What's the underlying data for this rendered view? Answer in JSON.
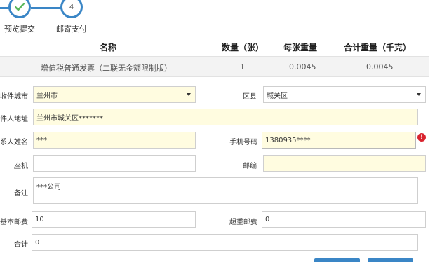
{
  "stepper": {
    "steps": [
      {
        "label": "预览提交",
        "number": "",
        "icon": "check-icon",
        "state": "done"
      },
      {
        "label": "邮寄支付",
        "number": "4",
        "icon": "",
        "state": "current"
      }
    ],
    "accent": "#3a86c6"
  },
  "table": {
    "headers": {
      "name": "名称",
      "qty": "数量（张）",
      "unit_weight": "每张重量",
      "total_weight": "合计重量（千克）"
    },
    "row": {
      "name": "增值税普通发票（二联无金额限制版）",
      "qty": "1",
      "unit_weight": "0.0045",
      "total_weight": "0.0045"
    }
  },
  "form": {
    "city": {
      "label": "收件城市",
      "value": "兰州市"
    },
    "district": {
      "label": "区县",
      "value": "城关区"
    },
    "address": {
      "label": "件人地址",
      "value": "兰州市城关区*******"
    },
    "contact": {
      "label": "系人姓名",
      "value": "***"
    },
    "phone": {
      "label": "手机号码",
      "value": "1380935****"
    },
    "landline": {
      "label": "座机",
      "value": ""
    },
    "postcode": {
      "label": "邮编",
      "value": ""
    },
    "remark": {
      "label": "备注",
      "value": "***公司"
    },
    "base_postage": {
      "label": "基本邮费",
      "value": "10"
    },
    "extra_postage": {
      "label": "超重邮费",
      "value": "0"
    },
    "total": {
      "label": "合计",
      "value": "0"
    }
  },
  "colors": {
    "required_field_bg": "#fffce0",
    "error": "#d9232e"
  }
}
